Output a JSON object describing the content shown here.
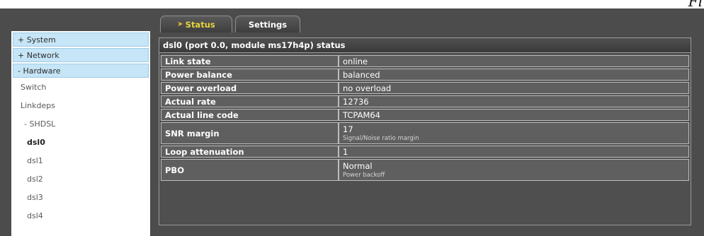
{
  "tabs": [
    {
      "label": "Status",
      "active": true
    },
    {
      "label": "Settings",
      "active": false
    }
  ],
  "sidebar": {
    "items": [
      {
        "label": "+ System",
        "kind": "group"
      },
      {
        "label": "+ Network",
        "kind": "group"
      },
      {
        "label": "- Hardware",
        "kind": "group"
      },
      {
        "label": "Switch",
        "kind": "item"
      },
      {
        "label": "Linkdeps",
        "kind": "item"
      },
      {
        "label": "- SHDSL",
        "kind": "item"
      },
      {
        "label": "dsl0",
        "kind": "item",
        "active": true
      },
      {
        "label": "dsl1",
        "kind": "item"
      },
      {
        "label": "dsl2",
        "kind": "item"
      },
      {
        "label": "dsl3",
        "kind": "item"
      },
      {
        "label": "dsl4",
        "kind": "item"
      }
    ]
  },
  "panel": {
    "title": "dsl0 (port 0.0, module ms17h4p) status",
    "rows": [
      {
        "label": "Link state",
        "value": "online",
        "sub": ""
      },
      {
        "label": "Power balance",
        "value": "balanced",
        "sub": ""
      },
      {
        "label": "Power overload",
        "value": "no overload",
        "sub": ""
      },
      {
        "label": "Actual rate",
        "value": "12736",
        "sub": ""
      },
      {
        "label": "Actual line code",
        "value": "TCPAM64",
        "sub": ""
      },
      {
        "label": "SNR margin",
        "value": "17",
        "sub": "Signal/Noise ratio margin"
      },
      {
        "label": "Loop attenuation",
        "value": "1",
        "sub": ""
      },
      {
        "label": "PBO",
        "value": "Normal",
        "sub": "Power backoff"
      }
    ]
  },
  "corner_text": "Fi",
  "colors": {
    "background": "#4c4c4c",
    "sidebar_group": "#c6e5f6",
    "row_fill": "#5f5f5f",
    "status_tab_text": "#e6d43a"
  },
  "icons": {
    "status_tab": "arrow-right-icon"
  }
}
